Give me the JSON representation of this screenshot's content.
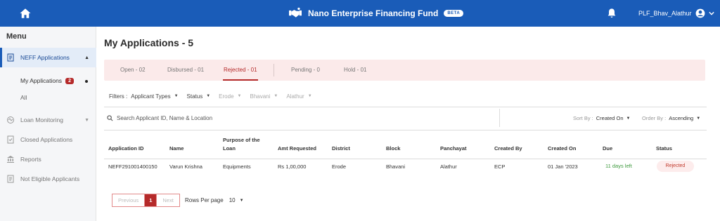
{
  "header": {
    "title": "Nano Enterprise Financing Fund",
    "beta": "BETA",
    "user": "PLF_Bhav_Alathur"
  },
  "sidebar": {
    "menu_title": "Menu",
    "items": [
      {
        "label": "NEFF Applications"
      },
      {
        "label": "Loan Monitoring"
      },
      {
        "label": "Closed Applications"
      },
      {
        "label": "Reports"
      },
      {
        "label": "Not Eligible Applicants"
      }
    ],
    "sub_items": [
      {
        "label": "My Applications",
        "badge": "2"
      },
      {
        "label": "All"
      }
    ]
  },
  "page": {
    "title": "My Applications - 5"
  },
  "tabs": [
    {
      "label": "Open - 02"
    },
    {
      "label": "Disbursed - 01"
    },
    {
      "label": "Rejected - 01"
    },
    {
      "label": "Pending - 0"
    },
    {
      "label": "Hold - 01"
    }
  ],
  "filters": {
    "label": "Filters :",
    "items": [
      "Applicant Types",
      "Status",
      "Erode",
      "Bhavani",
      "Alathur"
    ]
  },
  "search": {
    "placeholder": "Search Applicant ID, Name & Location"
  },
  "sort": {
    "sort_label": "Sort By :",
    "sort_value": "Created On",
    "order_label": "Order By :",
    "order_value": "Ascending"
  },
  "table": {
    "headers": [
      "Application ID",
      "Name",
      "Purpose of the",
      "Loan",
      "Amt Requested",
      "District",
      "Block",
      "Panchayat",
      "Created By",
      "Created On",
      "Due",
      "Status"
    ],
    "rows": [
      {
        "id": "NEFF291001400150",
        "name": "Varun Krishna",
        "purpose": "Equipments",
        "amount": "Rs 1,00,000",
        "district": "Erode",
        "block": "Bhavani",
        "panchayat": "Alathur",
        "created_by": "ECP",
        "created_on": "01 Jan '2023",
        "due": "11 days left",
        "status": "Rejected"
      }
    ]
  },
  "pagination": {
    "prev": "Previous",
    "current": "1",
    "next": "Next",
    "rows_label": "Rows Per page",
    "rows_value": "10"
  },
  "colors": {
    "primary": "#1a5cb8",
    "accent": "#b52a2a",
    "success": "#3f9a3f"
  }
}
